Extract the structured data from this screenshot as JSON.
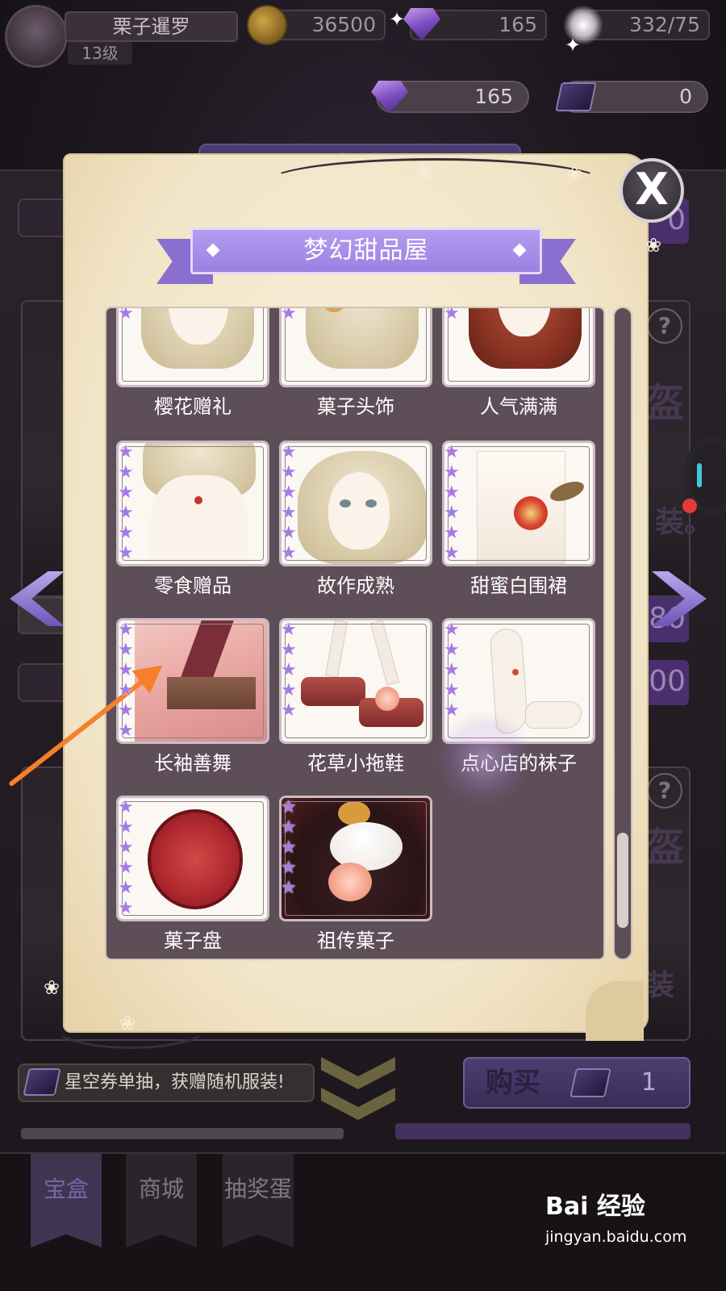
{
  "hud": {
    "player_name": "栗子暹罗",
    "player_level": "13级",
    "gold": "36500",
    "diamonds_top": "165",
    "stamina": "332/75",
    "diamonds": "165",
    "tickets": "0"
  },
  "background": {
    "tab_title": "宝盒",
    "promo_text": "星空券单抽，获赠随机服装!",
    "buy_label": "购买",
    "buy_count": "1",
    "bg_char_1": "盔",
    "bg_char_2": "盔",
    "bg_side_text_1": "装。",
    "bg_side_text_2": "装",
    "bg_price_1": "0",
    "bg_price_2": "80",
    "bg_price_3": "00",
    "help_glyph": "?"
  },
  "popup": {
    "title": "梦幻甜品屋",
    "close_glyph": "X",
    "items": [
      {
        "name": "樱花赠礼",
        "stars": 3
      },
      {
        "name": "菓子头饰",
        "stars": 3
      },
      {
        "name": "人气满满",
        "stars": 3
      },
      {
        "name": "零食赠品",
        "stars": 6
      },
      {
        "name": "故作成熟",
        "stars": 6
      },
      {
        "name": "甜蜜白围裙",
        "stars": 6
      },
      {
        "name": "长袖善舞",
        "stars": 6
      },
      {
        "name": "花草小拖鞋",
        "stars": 5
      },
      {
        "name": "点心店的袜子",
        "stars": 5
      },
      {
        "name": "菓子盘",
        "stars": 6
      },
      {
        "name": "祖传菓子",
        "stars": 5
      }
    ]
  },
  "bottom_nav": {
    "tabs": [
      {
        "label": "宝盒",
        "active": true
      },
      {
        "label": "商城",
        "active": false
      },
      {
        "label": "抽奖蛋",
        "active": false
      }
    ]
  },
  "watermark": {
    "brand": "Bai  经验",
    "url": "jingyan.baidu.com"
  },
  "colors": {
    "accent_purple": "#9c80e2",
    "annotation_arrow": "#f57f2a",
    "star": "#a57ae5"
  },
  "icons": [
    "coin-icon",
    "diamond-icon",
    "ticket-icon",
    "close-icon",
    "help-icon",
    "star-icon",
    "chevron-left-icon",
    "chevron-right-icon",
    "double-chevron-down-icon"
  ]
}
